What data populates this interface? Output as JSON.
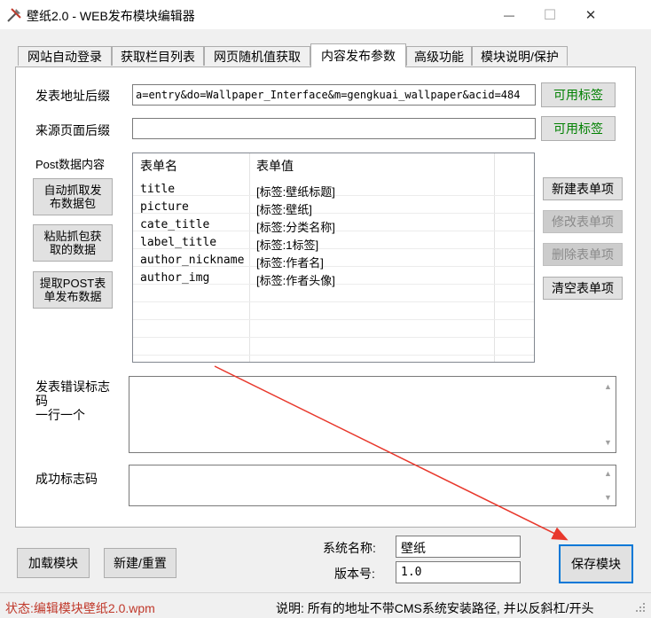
{
  "window": {
    "title": "壁纸2.0 - WEB发布模块编辑器",
    "min_glyph": "—",
    "max_glyph": "☐",
    "close_glyph": "✕"
  },
  "tabs": [
    {
      "label": "网站自动登录"
    },
    {
      "label": "获取栏目列表"
    },
    {
      "label": "网页随机值获取"
    },
    {
      "label": "内容发布参数"
    },
    {
      "label": "高级功能"
    },
    {
      "label": "模块说明/保护"
    }
  ],
  "active_tab": "内容发布参数",
  "publish_url": {
    "label": "发表地址后缀",
    "value": "a=entry&do=Wallpaper_Interface&m=gengkuai_wallpaper&acid=484",
    "tag_button": "可用标签"
  },
  "source_url": {
    "label": "来源页面后缀",
    "value": "",
    "tag_button": "可用标签"
  },
  "post_data": {
    "label": "Post数据内容",
    "buttons": {
      "auto_capture": "自动抓取发布数据包",
      "paste_capture": "粘贴抓包获取的数据",
      "extract_post": "提取POST表单发布数据"
    },
    "columns": [
      "表单名",
      "表单值"
    ],
    "rows": [
      {
        "name": "title",
        "value": "[标签:壁纸标题]"
      },
      {
        "name": "picture",
        "value": "[标签:壁纸]"
      },
      {
        "name": "cate_title",
        "value": "[标签:分类名称]"
      },
      {
        "name": "label_title",
        "value": "[标签:1标签]"
      },
      {
        "name": "author_nickname",
        "value": "[标签:作者名]"
      },
      {
        "name": "author_img",
        "value": "[标签:作者头像]"
      }
    ],
    "actions": {
      "new_item": "新建表单项",
      "edit_item": "修改表单项",
      "delete_item": "删除表单项",
      "clear_items": "清空表单项"
    }
  },
  "error_codes": {
    "label": "发表错误标志码\n一行一个",
    "value": ""
  },
  "success_codes": {
    "label": "成功标志码",
    "value": ""
  },
  "footer": {
    "load_button": "加载模块",
    "new_button": "新建/重置",
    "system_name_label": "系统名称:",
    "system_name_value": "壁纸",
    "version_label": "版本号:",
    "version_value": "1.0",
    "save_button": "保存模块"
  },
  "status": {
    "text": "状态:编辑模块壁纸2.0.wpm",
    "note": "说明: 所有的地址不带CMS系统安装路径, 并以反斜杠/开头"
  },
  "colors": {
    "accent": "#0078d7",
    "status_text": "#c0392b",
    "tag_button_text": "#008000",
    "annotation_arrow": "#e8382c"
  }
}
